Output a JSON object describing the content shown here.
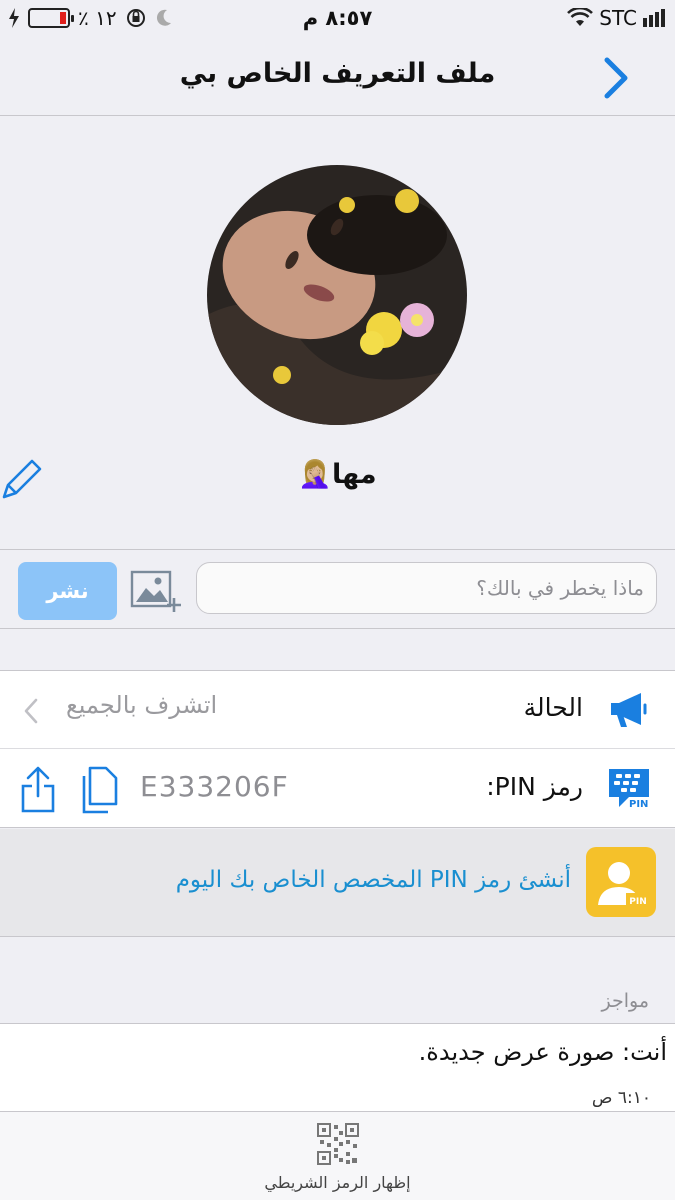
{
  "status_bar": {
    "battery_percent": "٪ ١٢",
    "time": "٨:٥٧ م",
    "carrier": "STC"
  },
  "nav": {
    "title": "ملف التعريف الخاص بي"
  },
  "profile": {
    "name": "مها🤦🏼‍♀️"
  },
  "post": {
    "placeholder": "ماذا يخطر في بالك؟",
    "publish_label": "نشر"
  },
  "status_row": {
    "label": "الحالة",
    "value": "اتشرف بالجميع"
  },
  "pin_row": {
    "label": "رمز PIN:",
    "value": "E333206F",
    "icon_badge": "PIN"
  },
  "promo": {
    "text": "أنشئ رمز PIN المخصص الخاص بك اليوم",
    "icon_badge": "PIN"
  },
  "updates": {
    "header": "مواجز",
    "items": [
      {
        "text": "أنت: صورة عرض جديدة.",
        "time": "٦:١٠ ص"
      }
    ]
  },
  "bottom_bar": {
    "barcode_label": "إظهار الرمز الشريطي"
  },
  "colors": {
    "accent": "#1a8fd0",
    "publish_button": "#8cc4f8",
    "promo_icon_bg": "#f5c12a",
    "battery_low": "#e0201c"
  }
}
